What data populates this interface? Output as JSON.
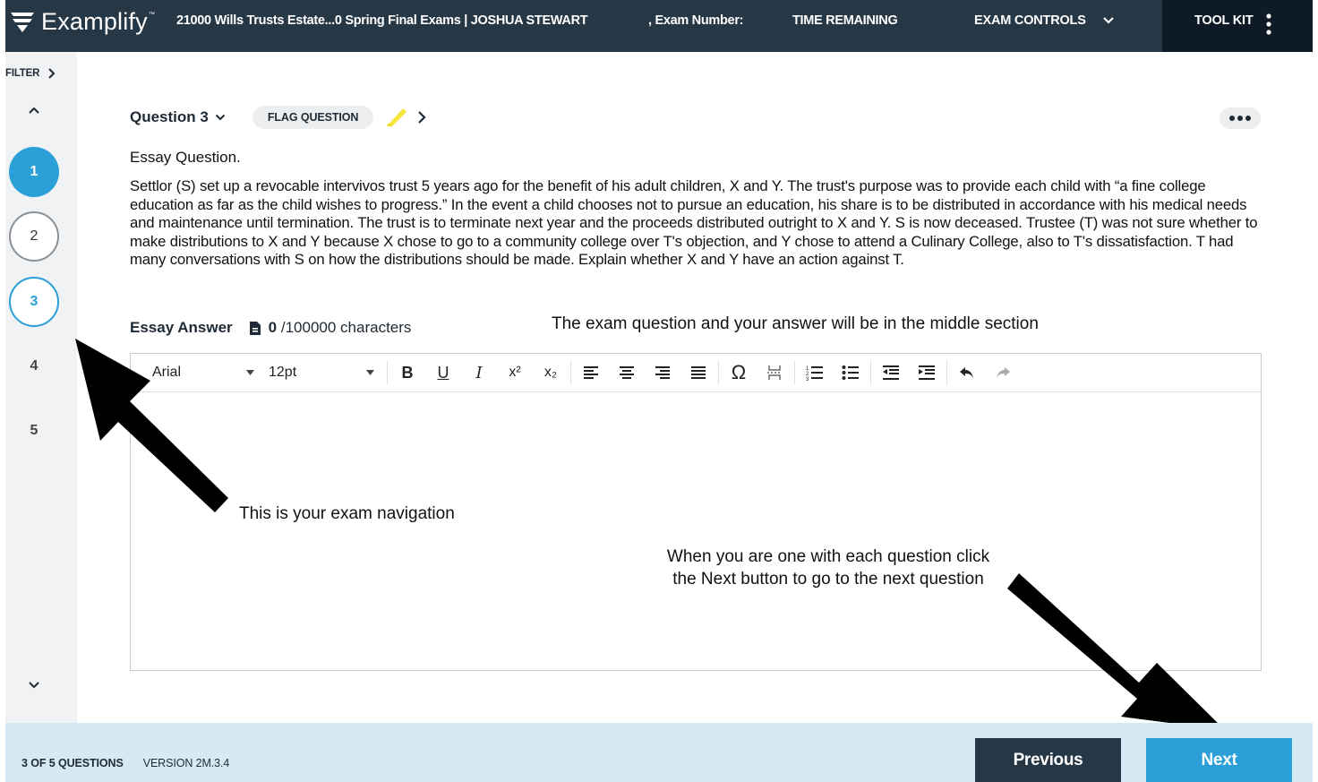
{
  "header": {
    "logo_text": "Examplify",
    "logo_tm": "™",
    "exam_title": "21000 Wills Trusts Estate...0 Spring Final Exams | JOSHUA STEWART",
    "exam_number_label": ", Exam Number:",
    "time_remaining_label": "TIME REMAINING",
    "exam_controls_label": "EXAM CONTROLS",
    "toolkit_label": "TOOL KIT"
  },
  "sidebar": {
    "filter_label": "FILTER",
    "questions": [
      {
        "number": "1",
        "state": "answered"
      },
      {
        "number": "2",
        "state": "visited"
      },
      {
        "number": "3",
        "state": "current"
      },
      {
        "number": "4",
        "state": "unvisited"
      },
      {
        "number": "5",
        "state": "unvisited"
      }
    ]
  },
  "question": {
    "title": "Question 3",
    "flag_label": "FLAG QUESTION",
    "type_label": "Essay Question.",
    "body": "Settlor (S) set up a revocable intervivos trust 5 years ago for the benefit of his adult children, X and Y. The trust's purpose was to provide each child with “a fine college education as far as the child wishes to progress.” In the event a child chooses not to pursue an education, his share is to be distributed in accordance with his medical needs and maintenance until termination. The trust is to terminate next year and the proceeds distributed outright to X and Y. S is now deceased. Trustee (T) was not sure whether to make distributions to X and Y because X chose to go to a community college over T's objection, and Y chose to attend a Culinary College, also to T's dissatisfaction. T had many conversations with S on how the distributions should be made. Explain whether X and Y have an action against T."
  },
  "answer": {
    "label": "Essay Answer",
    "char_count": "0",
    "char_limit": "/100000 characters",
    "font_family": "Arial",
    "font_size": "12pt",
    "content": ""
  },
  "annotations": {
    "navigation": "This is your exam navigation",
    "middle": "The exam question and your answer will be in the middle section",
    "next": "When you are one with each question click the Next button to go to the next question"
  },
  "footer": {
    "progress": "3 OF 5 QUESTIONS",
    "version": "VERSION 2M.3.4",
    "previous_label": "Previous",
    "next_label": "Next"
  },
  "colors": {
    "topbar": "#263746",
    "toolkit": "#0e1b26",
    "accent": "#2a9fd8",
    "footer": "#d6eaf5",
    "highlighter": "#f5e43a"
  }
}
